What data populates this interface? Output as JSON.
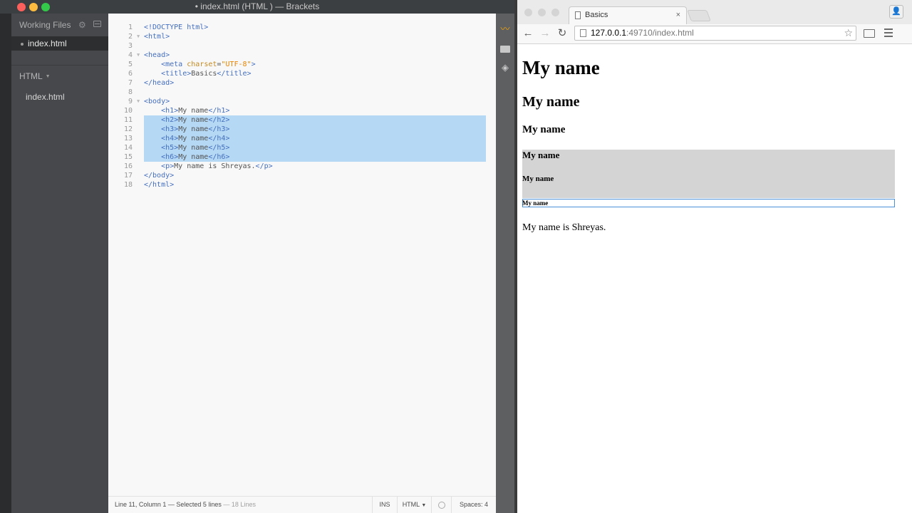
{
  "brackets": {
    "title": "• index.html (HTML ) — Brackets",
    "sidebar": {
      "working_files_label": "Working Files",
      "working_file": "index.html",
      "project_name": "HTML",
      "project_file": "index.html"
    },
    "code_lines": [
      {
        "n": "1",
        "fold": "",
        "html": "<span class='tag'>&lt;!DOCTYPE html&gt;</span>"
      },
      {
        "n": "2",
        "fold": "▼",
        "html": "<span class='tag'>&lt;html&gt;</span>"
      },
      {
        "n": "3",
        "fold": "",
        "html": ""
      },
      {
        "n": "4",
        "fold": "▼",
        "html": "<span class='tag'>&lt;head&gt;</span>"
      },
      {
        "n": "5",
        "fold": "",
        "html": "    <span class='tag'>&lt;meta</span> <span class='attr'>charset</span>=<span class='str'>\"UTF-8\"</span><span class='tag'>&gt;</span>"
      },
      {
        "n": "6",
        "fold": "",
        "html": "    <span class='tag'>&lt;title&gt;</span><span class='txt'>Basics</span><span class='tag'>&lt;/title&gt;</span>"
      },
      {
        "n": "7",
        "fold": "",
        "html": "<span class='tag'>&lt;/head&gt;</span>"
      },
      {
        "n": "8",
        "fold": "",
        "html": ""
      },
      {
        "n": "9",
        "fold": "▼",
        "html": "<span class='tag'>&lt;body&gt;</span>"
      },
      {
        "n": "10",
        "fold": "",
        "html": "    <span class='tag'>&lt;h1&gt;</span><span class='txt'>My name</span><span class='tag'>&lt;/h1&gt;</span>"
      },
      {
        "n": "11",
        "fold": "",
        "html": "    <span class='tag'>&lt;h2&gt;</span><span class='txt'>My name</span><span class='tag'>&lt;/h2&gt;</span>"
      },
      {
        "n": "12",
        "fold": "",
        "html": "    <span class='tag'>&lt;h3&gt;</span><span class='txt'>My name</span><span class='tag'>&lt;/h3&gt;</span>"
      },
      {
        "n": "13",
        "fold": "",
        "html": "    <span class='tag'>&lt;h4&gt;</span><span class='txt'>My name</span><span class='tag'>&lt;/h4&gt;</span>"
      },
      {
        "n": "14",
        "fold": "",
        "html": "    <span class='tag'>&lt;h5&gt;</span><span class='txt'>My name</span><span class='tag'>&lt;/h5&gt;</span>"
      },
      {
        "n": "15",
        "fold": "",
        "html": "    <span class='tag'>&lt;h6&gt;</span><span class='txt'>My name</span><span class='tag'>&lt;/h6&gt;</span>"
      },
      {
        "n": "16",
        "fold": "",
        "html": "    <span class='tag'>&lt;p&gt;</span><span class='txt'>My name is Shreyas.</span><span class='tag'>&lt;/p&gt;</span>"
      },
      {
        "n": "17",
        "fold": "",
        "html": "<span class='tag'>&lt;/body&gt;</span>"
      },
      {
        "n": "18",
        "fold": "",
        "html": "<span class='tag'>&lt;/html&gt;</span>"
      }
    ],
    "selection_lines": [
      11,
      12,
      13,
      14,
      15
    ],
    "status": {
      "cursor": "Line 11, Column 1 — Selected 5 lines",
      "lines": " — 18 Lines",
      "mode": "INS",
      "language": "HTML",
      "spaces": "Spaces:  4"
    }
  },
  "chrome": {
    "tab_title": "Basics",
    "tab_close": "×",
    "url_host": "127.0.0.1",
    "url_rest": ":49710/index.html",
    "star": "☆",
    "back": "←",
    "forward": "→",
    "reload": "↻",
    "profile": "👤"
  },
  "page": {
    "h1": "My name",
    "h2": "My name",
    "h3": "My name",
    "h4": "My name",
    "h5": "My name",
    "h6": "My name",
    "p": "My name is Shreyas."
  },
  "colors": {
    "selection": "#b5d9f5",
    "tag": "#446fbd",
    "inspector_highlight": "#d4d4d4",
    "inspector_outline": "#4a90d9"
  }
}
